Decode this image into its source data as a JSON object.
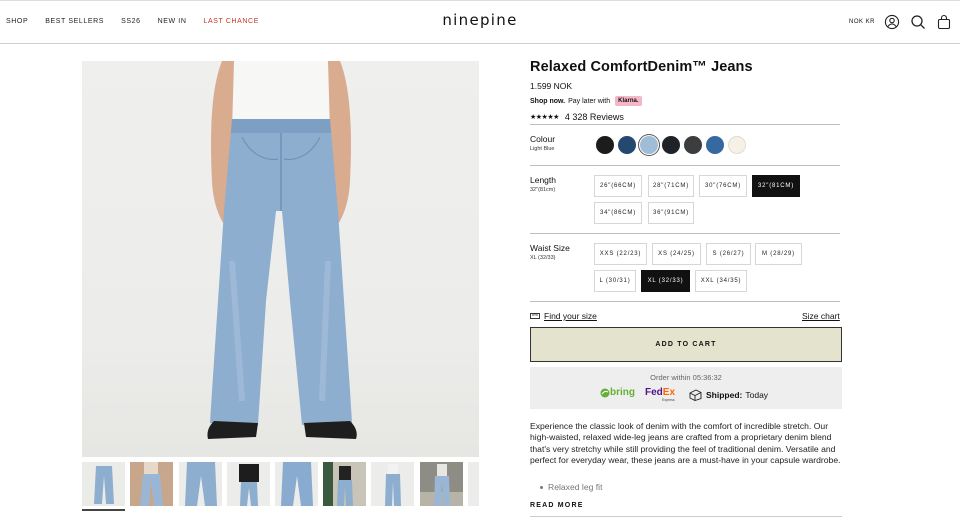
{
  "nav": {
    "items": [
      "SHOP",
      "BEST SELLERS",
      "SS26",
      "NEW IN",
      "LAST CHANCE"
    ],
    "logo": "ninepine",
    "currency": "NOK KR",
    "icons": [
      "account-icon",
      "search-icon",
      "bag-icon"
    ],
    "accent_last": "#c0392b"
  },
  "product": {
    "title": "Relaxed ComfortDenim™ Jeans",
    "price": "1.599 NOK",
    "shop_now": "Shop now.",
    "pay_later": "Pay later with",
    "klarna": "Klarna.",
    "stars": "★★★★★",
    "reviews": "4 328 Reviews"
  },
  "colour": {
    "label": "Colour",
    "value": "Light Blue",
    "swatches": [
      "#1c1c1c",
      "#24486e",
      "#9fbdd6",
      "#1f2328",
      "#3b3d3f",
      "#3569a0",
      "#f5f1e6"
    ],
    "selected_index": 2
  },
  "length": {
    "label": "Length",
    "value": "32\"(81cm)",
    "options": [
      "26\"(66CM)",
      "28\"(71CM)",
      "30\"(76CM)",
      "32\"(81CM)",
      "34\"(86CM)",
      "36\"(91CM)"
    ],
    "selected_index": 3
  },
  "waist": {
    "label": "Waist Size",
    "value": "XL (32/33)",
    "options": [
      "XXS (22/23)",
      "XS (24/25)",
      "S (26/27)",
      "M (28/29)",
      "L (30/31)",
      "XL (32/33)",
      "XXL (34/35)"
    ],
    "selected_index": 5
  },
  "fit": {
    "find_size": "Find your size",
    "size_chart": "Size chart"
  },
  "cart": {
    "label": "ADD TO CART",
    "bg": "#e4e3cd"
  },
  "shipping": {
    "order_within": "Order within 05:36:32",
    "bring": "bring",
    "fedex_fe": "Fed",
    "fedex_ex": "Ex",
    "fedex_sub": "Express",
    "shipped": "Shipped:",
    "today": "Today"
  },
  "description": {
    "text": "Experience the classic look of denim with the comfort of incredible stretch. Our high-waisted, relaxed wide-leg jeans are crafted from a proprietary denim blend that's very stretchy while still providing the feel of traditional denim. Versatile and perfect for everyday wear, these jeans are a must-have in your capsule wardrobe.",
    "bullet": "Relaxed leg fit",
    "read_more": "READ MORE"
  }
}
